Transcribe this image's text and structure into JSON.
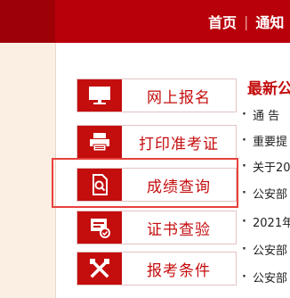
{
  "header": {
    "nav": [
      "首页",
      "通知"
    ]
  },
  "menu": {
    "items": [
      {
        "label": "网上报名",
        "icon": "monitor-icon"
      },
      {
        "label": "打印准考证",
        "icon": "printer-icon"
      },
      {
        "label": "成绩查询",
        "icon": "document-search-icon"
      },
      {
        "label": "证书查验",
        "icon": "certificate-check-icon"
      },
      {
        "label": "报考条件",
        "icon": "tools-icon"
      }
    ]
  },
  "news": {
    "title": "最新公",
    "items": [
      "通 告",
      "重要提",
      "关于20",
      "公安部",
      "2021年",
      "公安部",
      "公安部"
    ]
  },
  "colors": {
    "brand_red": "#c40d0d",
    "header_red": "#b8000a",
    "highlight": "#e8413d"
  }
}
